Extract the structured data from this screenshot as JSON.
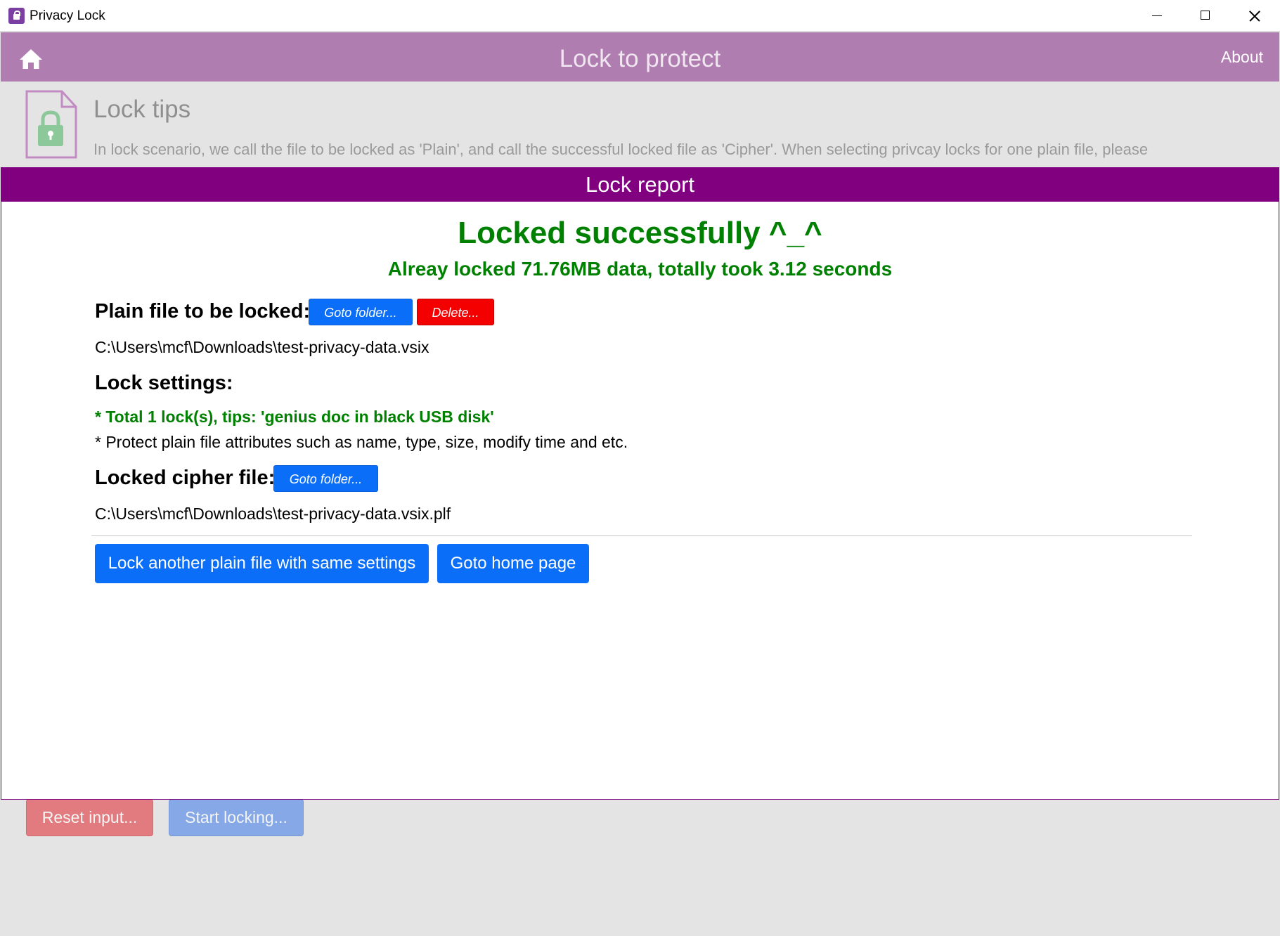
{
  "window": {
    "title": "Privacy Lock"
  },
  "header": {
    "title": "Lock to protect",
    "about_label": "About"
  },
  "tips": {
    "title": "Lock tips",
    "text": "In lock scenario, we call the file to be locked as 'Plain', and call the successful locked file as 'Cipher'. When selecting privcay locks for one plain file, please"
  },
  "background_buttons": {
    "reset_label": "Reset input...",
    "start_label": "Start locking..."
  },
  "report": {
    "header": "Lock report",
    "success_title": "Locked successfully ^_^",
    "success_subtitle": "Alreay locked 71.76MB data, totally took 3.12 seconds",
    "plain_label": "Plain file to be locked:",
    "plain_goto_label": "Goto folder...",
    "plain_delete_label": "Delete...",
    "plain_path": "C:\\Users\\mcf\\Downloads\\test-privacy-data.vsix",
    "settings_label": "Lock settings:",
    "settings_locks": "* Total 1 lock(s), tips: 'genius doc in black USB disk'",
    "settings_protect": "* Protect plain file attributes such as name, type, size, modify time and etc.",
    "cipher_label": "Locked cipher file:",
    "cipher_goto_label": "Goto folder...",
    "cipher_path": "C:\\Users\\mcf\\Downloads\\test-privacy-data.vsix.plf",
    "lock_another_label": "Lock another plain file with same settings",
    "goto_home_label": "Goto home page"
  },
  "colors": {
    "header_bg": "#b07db1",
    "report_header_bg": "#800080",
    "success_green": "#008000",
    "button_blue": "#0b6ef8",
    "button_red": "#f40000"
  }
}
